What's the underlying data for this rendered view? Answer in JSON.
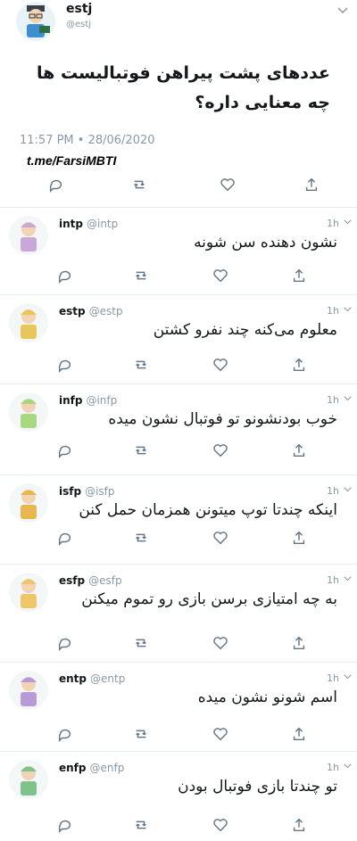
{
  "main_tweet": {
    "name": "estj",
    "handle": "@estj",
    "text": "عددهای پشت پیراهن فوتبالیست ها چه معنایی داره؟",
    "timestamp": "11:57 PM • 28/06/2020",
    "watermark": "t.me/FarsiMBTI",
    "menu_icon": "chevron-down-icon",
    "actions": [
      "reply-icon",
      "retweet-icon",
      "like-icon",
      "share-icon"
    ]
  },
  "replies": [
    {
      "name": "intp",
      "handle": "@intp",
      "time": "1h",
      "text": "نشون دهنده سن شونه",
      "avatar_color": "#c9a7d9"
    },
    {
      "name": "estp",
      "handle": "@estp",
      "time": "1h",
      "text": "معلوم می‌کنه چند نفرو کشتن",
      "avatar_color": "#e8c65a"
    },
    {
      "name": "infp",
      "handle": "@infp",
      "time": "1h",
      "text": "خوب بودنشونو تو فوتبال نشون میده",
      "avatar_color": "#a7d77f"
    },
    {
      "name": "isfp",
      "handle": "@isfp",
      "time": "1h",
      "text": "اینکه چندتا توپ میتونن همزمان حمل کنن",
      "avatar_color": "#e9b64f"
    },
    {
      "name": "esfp",
      "handle": "@esfp",
      "time": "1h",
      "text": "به چه امتیازی برسن بازی رو تموم میکنن",
      "avatar_color": "#f0c66a"
    },
    {
      "name": "entp",
      "handle": "@entp",
      "time": "1h",
      "text": "اسم شونو نشون میده",
      "avatar_color": "#b79ad6"
    },
    {
      "name": "enfp",
      "handle": "@enfp",
      "time": "1h",
      "text": "تو چندتا بازی فوتبال بودن",
      "avatar_color": "#7fc28a"
    }
  ]
}
